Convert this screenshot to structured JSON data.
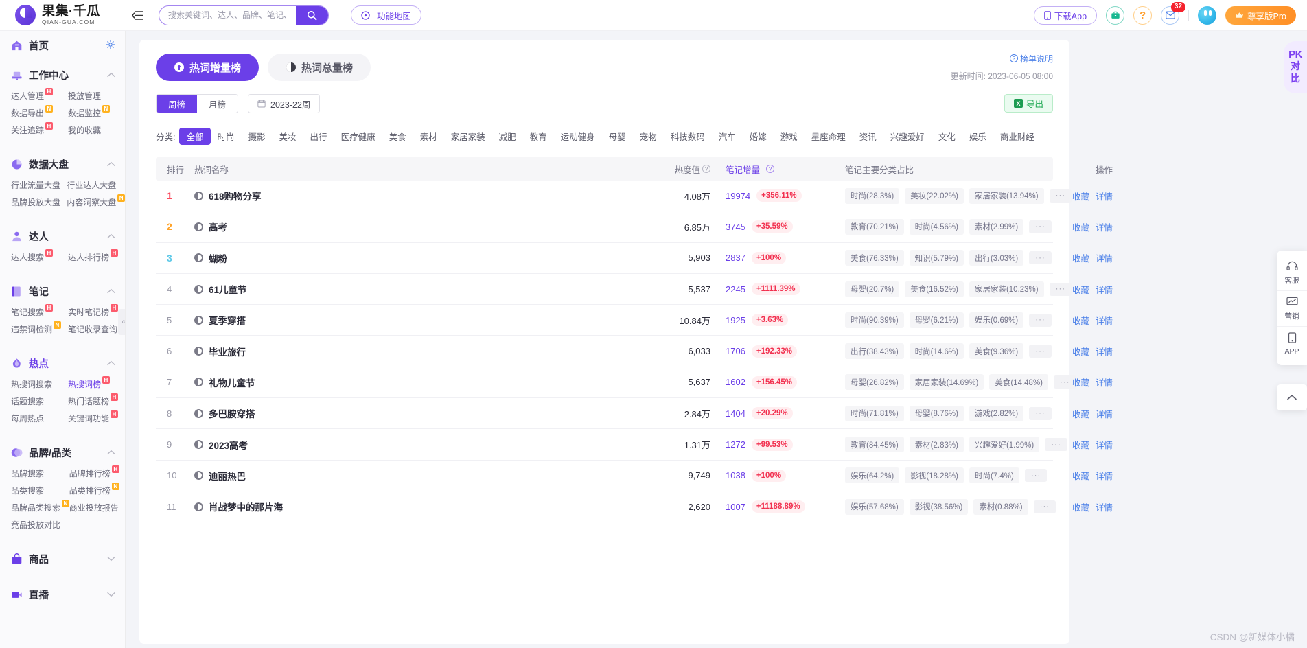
{
  "header": {
    "logo_title": "果集·千瓜",
    "logo_sub": "QIAN-GUA.COM",
    "collapse_icon": "menu-fold-icon",
    "search": {
      "placeholder": "搜索关键词、达人、品牌、笔记、商品等",
      "value": "",
      "icon": "search-icon"
    },
    "feature_map_label": "功能地图",
    "download_app_label": "下载App",
    "toolbox_icon": "toolbox-icon",
    "help_icon": "question-icon",
    "mail_icon": "mail-icon",
    "mail_badge": "32",
    "avatar": "user-avatar",
    "pro_label": "尊享版Pro"
  },
  "sidebar": {
    "home": {
      "label": "首页",
      "icon": "home-icon",
      "settings_icon": "gear-icon"
    },
    "sections": [
      {
        "label": "工作中心",
        "icon": "workbench-icon",
        "expanded": true,
        "items": [
          {
            "label": "达人管理",
            "badge": "H"
          },
          {
            "label": "投放管理",
            "badge": ""
          },
          {
            "label": "数据导出",
            "badge": "N"
          },
          {
            "label": "数据监控",
            "badge": "N"
          },
          {
            "label": "关注追踪",
            "badge": "H"
          },
          {
            "label": "我的收藏",
            "badge": ""
          }
        ]
      },
      {
        "label": "数据大盘",
        "icon": "pie-icon",
        "expanded": true,
        "items": [
          {
            "label": "行业流量大盘",
            "badge": ""
          },
          {
            "label": "行业达人大盘",
            "badge": ""
          },
          {
            "label": "品牌投放大盘",
            "badge": ""
          },
          {
            "label": "内容洞察大盘",
            "badge": "N"
          }
        ]
      },
      {
        "label": "达人",
        "icon": "person-icon",
        "expanded": true,
        "items": [
          {
            "label": "达人搜索",
            "badge": "H"
          },
          {
            "label": "达人排行榜",
            "badge": "H"
          }
        ]
      },
      {
        "label": "笔记",
        "icon": "note-icon",
        "expanded": true,
        "items": [
          {
            "label": "笔记搜索",
            "badge": "H"
          },
          {
            "label": "实时笔记榜",
            "badge": "H"
          },
          {
            "label": "违禁词检测",
            "badge": "N"
          },
          {
            "label": "笔记收录查询",
            "badge": ""
          }
        ]
      },
      {
        "label": "热点",
        "icon": "fire-icon",
        "expanded": true,
        "active": true,
        "items": [
          {
            "label": "热搜词搜索",
            "badge": ""
          },
          {
            "label": "热搜词榜",
            "badge": "H",
            "active": true
          },
          {
            "label": "话题搜索",
            "badge": ""
          },
          {
            "label": "热门话题榜",
            "badge": "H"
          },
          {
            "label": "每周热点",
            "badge": ""
          },
          {
            "label": "关键词功能",
            "badge": "H"
          }
        ]
      },
      {
        "label": "品牌/品类",
        "icon": "brand-icon",
        "expanded": true,
        "items": [
          {
            "label": "品牌搜索",
            "badge": ""
          },
          {
            "label": "品牌排行榜",
            "badge": "H"
          },
          {
            "label": "品类搜索",
            "badge": ""
          },
          {
            "label": "品类排行榜",
            "badge": "N"
          },
          {
            "label": "品牌品类搜索",
            "badge": "N"
          },
          {
            "label": "商业投放报告",
            "badge": ""
          },
          {
            "label": "竞品投放对比",
            "badge": ""
          }
        ]
      },
      {
        "label": "商品",
        "icon": "bag-icon",
        "expanded": false,
        "items": []
      },
      {
        "label": "直播",
        "icon": "live-icon",
        "expanded": false,
        "items": []
      }
    ],
    "collapse_icon": "chevron-left-double-icon"
  },
  "main": {
    "tabs": [
      {
        "label": "热词增量榜",
        "icon": "arrow-up-circle-icon",
        "active": true
      },
      {
        "label": "热词总量榜",
        "icon": "contrast-circle-icon",
        "active": false
      }
    ],
    "rank_note_label": "榜单说明",
    "update_time": "更新时间: 2023-06-05 08:00",
    "period_toggle": [
      {
        "label": "周榜",
        "active": true
      },
      {
        "label": "月榜",
        "active": false
      }
    ],
    "date_value": "2023-22周",
    "date_icon": "calendar-icon",
    "export_label": "导出",
    "export_icon": "excel-icon",
    "category_label": "分类:",
    "categories": [
      {
        "label": "全部",
        "active": true
      },
      {
        "label": "时尚"
      },
      {
        "label": "摄影"
      },
      {
        "label": "美妆"
      },
      {
        "label": "出行"
      },
      {
        "label": "医疗健康"
      },
      {
        "label": "美食"
      },
      {
        "label": "素材"
      },
      {
        "label": "家居家装"
      },
      {
        "label": "减肥"
      },
      {
        "label": "教育"
      },
      {
        "label": "运动健身"
      },
      {
        "label": "母婴"
      },
      {
        "label": "宠物"
      },
      {
        "label": "科技数码"
      },
      {
        "label": "汽车"
      },
      {
        "label": "婚嫁"
      },
      {
        "label": "游戏"
      },
      {
        "label": "星座命理"
      },
      {
        "label": "资讯"
      },
      {
        "label": "兴趣爱好"
      },
      {
        "label": "文化"
      },
      {
        "label": "娱乐"
      },
      {
        "label": "商业财经"
      }
    ],
    "table": {
      "columns": {
        "rank": "排行",
        "name": "热词名称",
        "heat": "热度值",
        "increment": "笔记增量",
        "cat_share": "笔记主要分类占比",
        "op": "操作"
      },
      "op_labels": {
        "fav": "收藏",
        "detail": "详情"
      },
      "more_label": "···",
      "rows": [
        {
          "rank": "1",
          "name": "618购物分享",
          "heat": "4.08万",
          "inc": "19974",
          "pct": "+356.11%",
          "cats": [
            "时尚(28.3%)",
            "美妆(22.02%)",
            "家居家装(13.94%)"
          ]
        },
        {
          "rank": "2",
          "name": "高考",
          "heat": "6.85万",
          "inc": "3745",
          "pct": "+35.59%",
          "cats": [
            "教育(70.21%)",
            "时尚(4.56%)",
            "素材(2.99%)"
          ]
        },
        {
          "rank": "3",
          "name": "蝴粉",
          "heat": "5,903",
          "inc": "2837",
          "pct": "+100%",
          "cats": [
            "美食(76.33%)",
            "知识(5.79%)",
            "出行(3.03%)"
          ]
        },
        {
          "rank": "4",
          "name": "61儿童节",
          "heat": "5,537",
          "inc": "2245",
          "pct": "+1111.39%",
          "cats": [
            "母婴(20.7%)",
            "美食(16.52%)",
            "家居家装(10.23%)"
          ]
        },
        {
          "rank": "5",
          "name": "夏季穿搭",
          "heat": "10.84万",
          "inc": "1925",
          "pct": "+3.63%",
          "cats": [
            "时尚(90.39%)",
            "母婴(6.21%)",
            "娱乐(0.69%)"
          ]
        },
        {
          "rank": "6",
          "name": "毕业旅行",
          "heat": "6,033",
          "inc": "1706",
          "pct": "+192.33%",
          "cats": [
            "出行(38.43%)",
            "时尚(14.6%)",
            "美食(9.36%)"
          ]
        },
        {
          "rank": "7",
          "name": "礼物儿童节",
          "heat": "5,637",
          "inc": "1602",
          "pct": "+156.45%",
          "cats": [
            "母婴(26.82%)",
            "家居家装(14.69%)",
            "美食(14.48%)"
          ]
        },
        {
          "rank": "8",
          "name": "多巴胺穿搭",
          "heat": "2.84万",
          "inc": "1404",
          "pct": "+20.29%",
          "cats": [
            "时尚(71.81%)",
            "母婴(8.76%)",
            "游戏(2.82%)"
          ]
        },
        {
          "rank": "9",
          "name": "2023高考",
          "heat": "1.31万",
          "inc": "1272",
          "pct": "+99.53%",
          "cats": [
            "教育(84.45%)",
            "素材(2.83%)",
            "兴趣爱好(1.99%)"
          ]
        },
        {
          "rank": "10",
          "name": "迪丽热巴",
          "heat": "9,749",
          "inc": "1038",
          "pct": "+100%",
          "cats": [
            "娱乐(64.2%)",
            "影视(18.28%)",
            "时尚(7.4%)"
          ]
        },
        {
          "rank": "11",
          "name": "肖战梦中的那片海",
          "heat": "2,620",
          "inc": "1007",
          "pct": "+11188.89%",
          "cats": [
            "娱乐(57.68%)",
            "影视(38.56%)",
            "素材(0.88%)"
          ]
        }
      ]
    }
  },
  "rail": {
    "items": [
      {
        "label": "客服",
        "icon": "headset-icon"
      },
      {
        "label": "营销",
        "icon": "chart-monitor-icon"
      },
      {
        "label": "APP",
        "icon": "phone-icon"
      }
    ],
    "backtop_icon": "chevron-up-icon"
  },
  "pk_tab": {
    "pk": "PK",
    "line1": "对",
    "line2": "比"
  },
  "watermark": "CSDN @新媒体小橘"
}
